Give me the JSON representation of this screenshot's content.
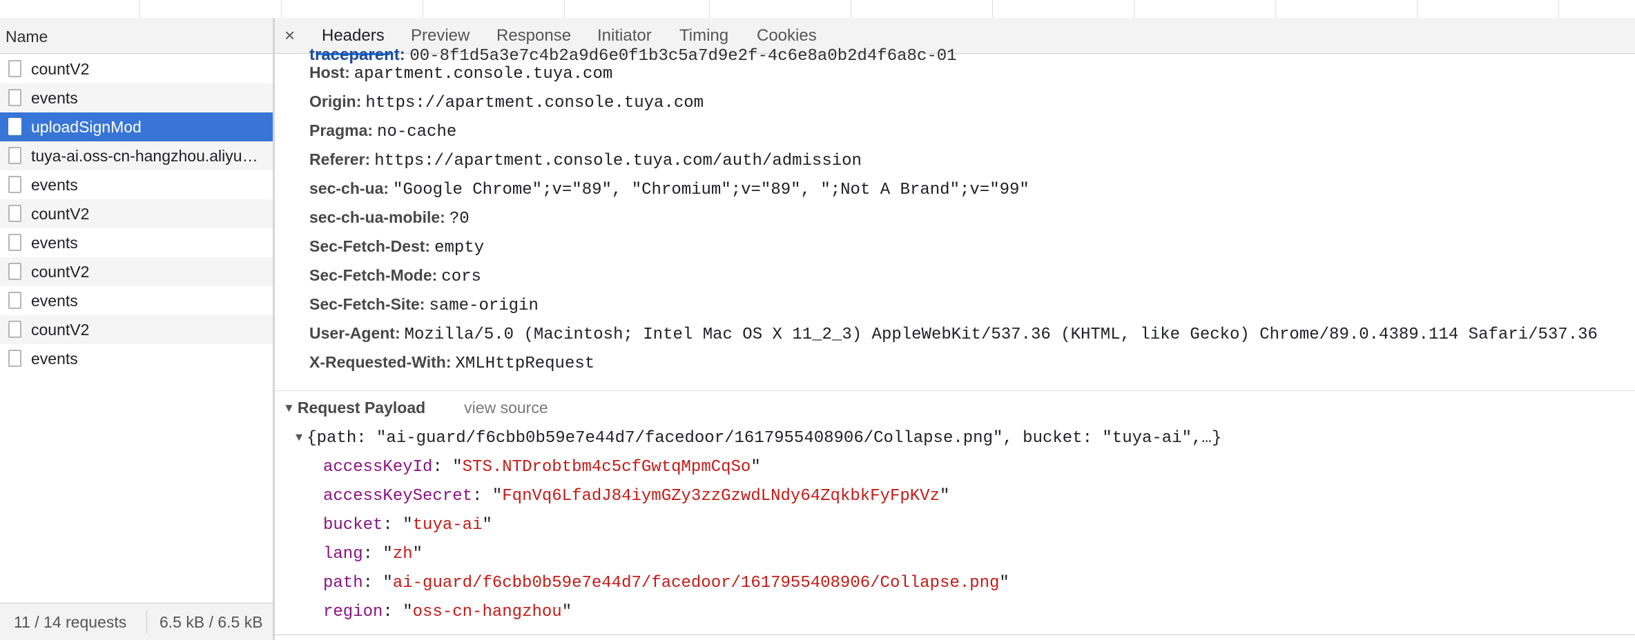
{
  "name_column": {
    "header": "Name"
  },
  "requests": [
    {
      "name": "countV2",
      "selected": false
    },
    {
      "name": "events",
      "selected": false
    },
    {
      "name": "uploadSignMod",
      "selected": true
    },
    {
      "name": "tuya-ai.oss-cn-hangzhou.aliyuncs.com",
      "selected": false
    },
    {
      "name": "events",
      "selected": false
    },
    {
      "name": "countV2",
      "selected": false
    },
    {
      "name": "events",
      "selected": false
    },
    {
      "name": "countV2",
      "selected": false
    },
    {
      "name": "events",
      "selected": false
    },
    {
      "name": "countV2",
      "selected": false
    },
    {
      "name": "events",
      "selected": false
    }
  ],
  "footer": {
    "requests": "11 / 14 requests",
    "size": "6.5 kB / 6.5 kB"
  },
  "tabs": {
    "close": "×",
    "headers": "Headers",
    "preview": "Preview",
    "response": "Response",
    "initiator": "Initiator",
    "timing": "Timing",
    "cookies": "Cookies",
    "active": "Headers"
  },
  "partial_header": {
    "key": "traceparent:",
    "value": "00-8f1d5a3e7c4b2a9d6e0f1b3c5a7d9e2f-4c6e8a0b2d4f6a8c-01"
  },
  "request_headers": [
    {
      "key": "Host:",
      "value": "apartment.console.tuya.com"
    },
    {
      "key": "Origin:",
      "value": "https://apartment.console.tuya.com"
    },
    {
      "key": "Pragma:",
      "value": "no-cache"
    },
    {
      "key": "Referer:",
      "value": "https://apartment.console.tuya.com/auth/admission"
    },
    {
      "key": "sec-ch-ua:",
      "value": "\"Google Chrome\";v=\"89\", \"Chromium\";v=\"89\", \";Not A Brand\";v=\"99\""
    },
    {
      "key": "sec-ch-ua-mobile:",
      "value": "?0"
    },
    {
      "key": "Sec-Fetch-Dest:",
      "value": "empty"
    },
    {
      "key": "Sec-Fetch-Mode:",
      "value": "cors"
    },
    {
      "key": "Sec-Fetch-Site:",
      "value": "same-origin"
    },
    {
      "key": "User-Agent:",
      "value": "Mozilla/5.0 (Macintosh; Intel Mac OS X 11_2_3) AppleWebKit/537.36 (KHTML, like Gecko) Chrome/89.0.4389.114 Safari/537.36"
    },
    {
      "key": "X-Requested-With:",
      "value": "XMLHttpRequest"
    }
  ],
  "payload": {
    "title": "Request Payload",
    "view_source": "view source",
    "summary": "{path: \"ai-guard/f6cbb0b59e7e44d7/facedoor/1617955408906/Collapse.png\", bucket: \"tuya-ai\",…}",
    "fields": [
      {
        "key": "accessKeyId",
        "value": "STS.NTDrobtbm4c5cfGwtqMpmCqSo"
      },
      {
        "key": "accessKeySecret",
        "value": "FqnVq6LfadJ84iymGZy3zzGzwdLNdy64ZqkbkFyFpKVz"
      },
      {
        "key": "bucket",
        "value": "tuya-ai"
      },
      {
        "key": "lang",
        "value": "zh"
      },
      {
        "key": "path",
        "value": "ai-guard/f6cbb0b59e7e44d7/facedoor/1617955408906/Collapse.png"
      },
      {
        "key": "region",
        "value": "oss-cn-hangzhou"
      }
    ]
  },
  "colors": {
    "selected_row": "#3875d7",
    "header_key": "#474747",
    "payload_key": "#881280",
    "payload_value": "#c41a16",
    "active_tab_underline": "#1a73e8"
  }
}
